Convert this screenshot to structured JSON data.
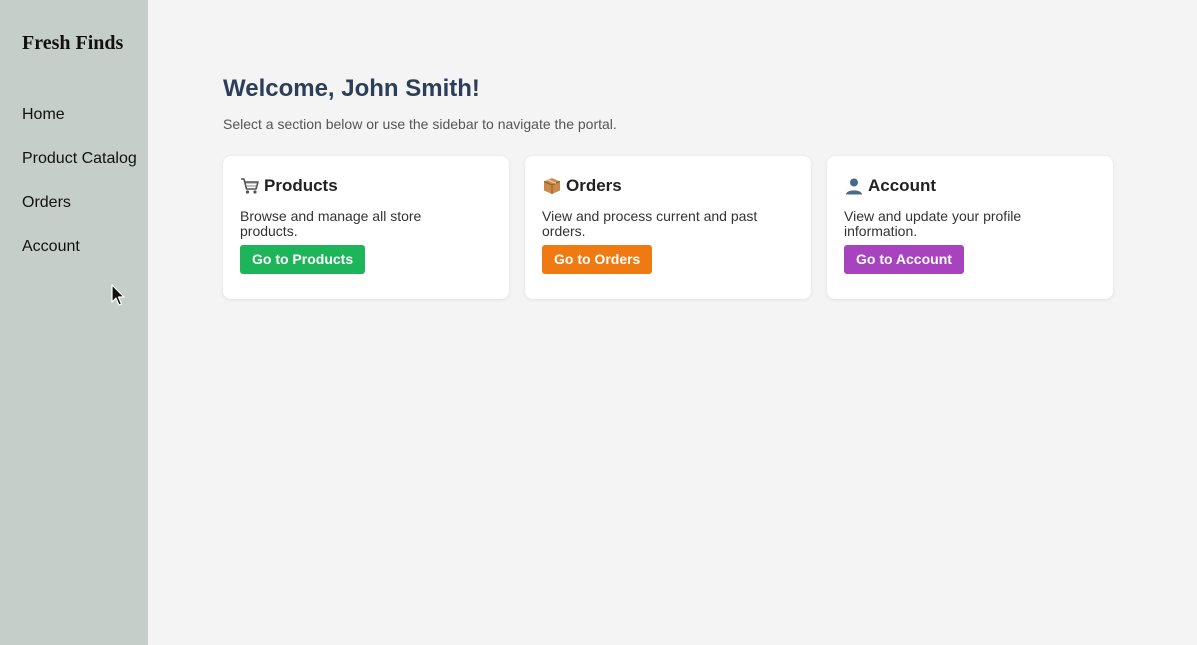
{
  "sidebar": {
    "brand": "Fresh Finds",
    "items": [
      {
        "label": "Home"
      },
      {
        "label": "Product Catalog"
      },
      {
        "label": "Orders"
      },
      {
        "label": "Account"
      }
    ],
    "background": "#c6cec9"
  },
  "main": {
    "welcome": "Welcome, John Smith!",
    "subtitle": "Select a section below or use the sidebar to navigate the portal.",
    "cards": [
      {
        "icon": "shopping-cart-icon",
        "title": "Products",
        "description": "Browse and manage all store products.",
        "button_label": "Go to Products",
        "button_color": "#1eb45a"
      },
      {
        "icon": "package-icon",
        "title": "Orders",
        "description": "View and process current and past orders.",
        "button_label": "Go to Orders",
        "button_color": "#f07a12"
      },
      {
        "icon": "user-icon",
        "title": "Account",
        "description": "View and update your profile information.",
        "button_label": "Go to Account",
        "button_color": "#a843c0"
      }
    ]
  }
}
